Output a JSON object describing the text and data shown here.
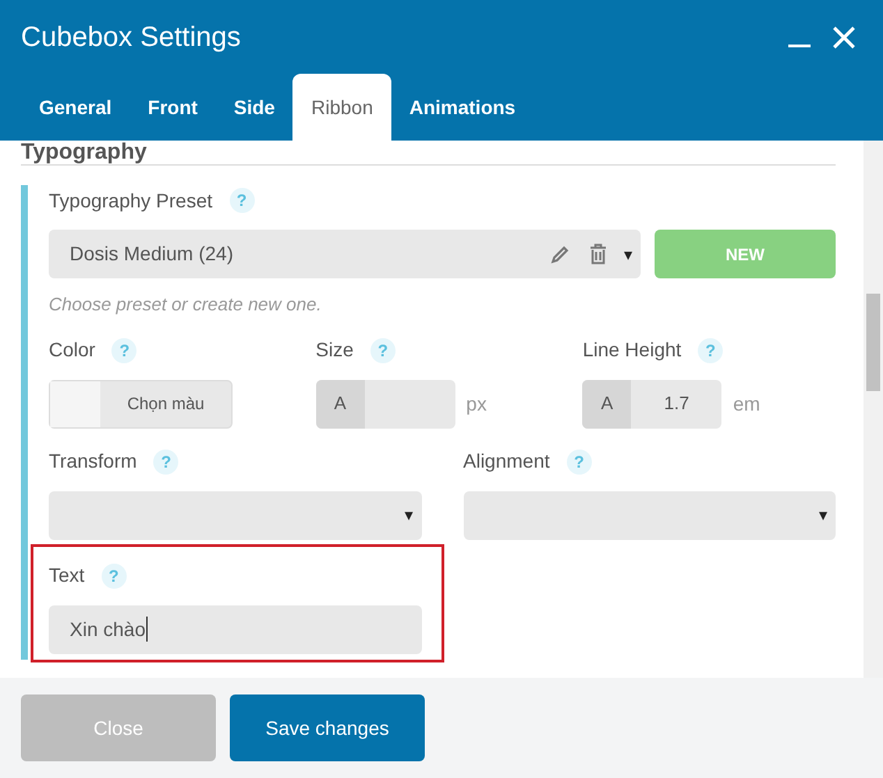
{
  "window": {
    "title": "Cubebox Settings"
  },
  "tabs": [
    {
      "label": "General",
      "selected": false
    },
    {
      "label": "Front",
      "selected": false
    },
    {
      "label": "Side",
      "selected": false
    },
    {
      "label": "Ribbon",
      "selected": true
    },
    {
      "label": "Animations",
      "selected": false
    }
  ],
  "section": {
    "title": "Typography"
  },
  "preset": {
    "label": "Typography Preset",
    "help": "?",
    "value": "Dosis Medium (24)",
    "caret": "▾",
    "new_button": "NEW",
    "hint": "Choose preset or create new one."
  },
  "row1": [
    {
      "kind": "color",
      "label": "Color",
      "help": "?",
      "button": "Chọn màu"
    },
    {
      "kind": "number",
      "label": "Size",
      "help": "?",
      "prefix": "A",
      "unit": "px"
    },
    {
      "kind": "number",
      "label": "Line Height",
      "help": "?",
      "prefix": "A",
      "value": "1.7",
      "unit": "em"
    }
  ],
  "row2": [
    {
      "kind": "select",
      "label": "Transform",
      "help": "?",
      "caret": "▾"
    },
    {
      "kind": "select",
      "label": "Alignment",
      "help": "?",
      "caret": "▾"
    }
  ],
  "text_field": {
    "label": "Text",
    "help": "?",
    "value": "Xin chào",
    "highlighted": true
  },
  "footer": {
    "buttons": [
      {
        "label": "Close",
        "kind": "secondary"
      },
      {
        "label": "Save changes",
        "kind": "primary"
      }
    ]
  }
}
